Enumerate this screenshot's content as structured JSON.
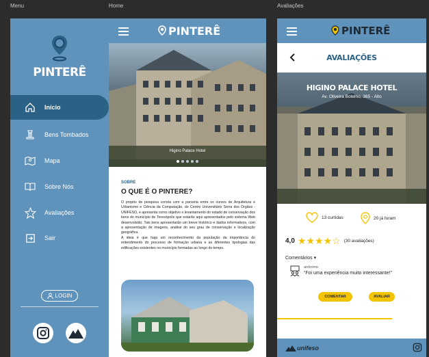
{
  "frames": {
    "menu_label": "Menu",
    "home_label": "Home",
    "aval_label": "Avaliações"
  },
  "menu": {
    "brand": "PINTERÊ",
    "items": [
      {
        "label": "Início",
        "icon": "home-icon"
      },
      {
        "label": "Bens Tombados",
        "icon": "monument-icon"
      },
      {
        "label": "Mapa",
        "icon": "map-icon"
      },
      {
        "label": "Sobre Nós",
        "icon": "book-icon"
      },
      {
        "label": "Avaliações",
        "icon": "star-icon"
      },
      {
        "label": "Sair",
        "icon": "logout-icon"
      }
    ],
    "login": "LOGIN",
    "colors": {
      "bg": "#5f93bb",
      "active": "#2b6185"
    }
  },
  "home": {
    "brand": "PINTERÊ",
    "caption": "Higino Palace Hotel",
    "section": "SOBRE",
    "heading": "O QUE É O PINTERE?",
    "paragraph1": "O projeto de pesquisa consta com a parceria entre os cursos de Arquitetura e Urbanismo e Ciência da Computação, do Centro Universitário Serra dos Órgãos - UNIFESO, e apresenta como objetivo o levantamento do estado de conservação dos bens do município de Teresópolis que estarão aqui apresentados pelo sistema Web desenvolvido. Tais bens apresentarão um breve histórico e dados informativos, com a apresentação de imagens, análise do seu grau de conservação e localização geográfica.",
    "paragraph2": "A ideia é que haja um reconhecimento da população da importância do entendimento do processo de formação urbana e as diferentes tipologias das edificações existentes no município formadas ao longo do tempo."
  },
  "aval": {
    "brand": "PINTERÊ",
    "title": "AVALIAÇÕES",
    "hotel_name": "HIGINO PALACE HOTEL",
    "hotel_address": "Av. Oliveira Botelho, 365 - Alto",
    "likes": "13 curtidas",
    "visited": "20 já foram",
    "rating": "4,0",
    "rating_value": 4,
    "rating_max": 5,
    "rating_count": "(30 avaliações)",
    "comments_label": "Comentários ▾",
    "comment_author": "anônimo",
    "comment_text": "“Foi uma experiência muito interessante!”",
    "btn_comment": "COMENTAR",
    "btn_rate": "AVALIAR",
    "footer_logo": "unifeso"
  }
}
